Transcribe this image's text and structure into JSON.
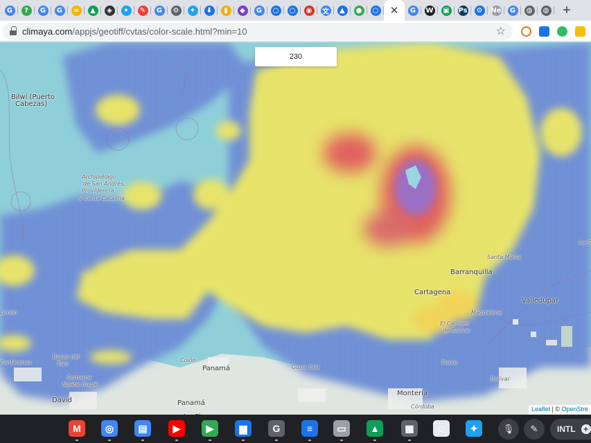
{
  "browser": {
    "tabs": [
      {
        "icon": "google-icon",
        "color": "#4285f4",
        "glyph": "G"
      },
      {
        "icon": "help-icon",
        "color": "#34a853",
        "glyph": "?"
      },
      {
        "icon": "google-icon",
        "color": "#4285f4",
        "glyph": "G"
      },
      {
        "icon": "google-icon",
        "color": "#4285f4",
        "glyph": "G"
      },
      {
        "icon": "infinity-icon",
        "color": "#f4b400",
        "glyph": "∞"
      },
      {
        "icon": "drive-icon",
        "color": "#0f9d58",
        "glyph": "▲"
      },
      {
        "icon": "shield-icon",
        "color": "#333333",
        "glyph": "◈"
      },
      {
        "icon": "twitter-icon",
        "color": "#1da1f2",
        "glyph": "✦"
      },
      {
        "icon": "pen-icon",
        "color": "#ea4335",
        "glyph": "✎"
      },
      {
        "icon": "google-icon",
        "color": "#4285f4",
        "glyph": "G"
      },
      {
        "icon": "search-icon",
        "color": "#5f6368",
        "glyph": "⚙"
      },
      {
        "icon": "twitter-icon",
        "color": "#1da1f2",
        "glyph": "✦"
      },
      {
        "icon": "download-icon",
        "color": "#1a73e8",
        "glyph": "⬇"
      },
      {
        "icon": "analytics-icon",
        "color": "#f9ab00",
        "glyph": "▮"
      },
      {
        "icon": "cube-icon",
        "color": "#7b3fbf",
        "glyph": "◆"
      },
      {
        "icon": "google-icon",
        "color": "#4285f4",
        "glyph": "G"
      },
      {
        "icon": "climaya-icon",
        "color": "#1a73e8",
        "glyph": "○"
      },
      {
        "icon": "climaya-icon",
        "color": "#1a73e8",
        "glyph": "○"
      },
      {
        "icon": "red-app-icon",
        "color": "#d93025",
        "glyph": "◉"
      },
      {
        "icon": "translate-icon",
        "color": "#4285f4",
        "glyph": "文"
      },
      {
        "icon": "triangle-icon",
        "color": "#1a73e8",
        "glyph": "▲"
      },
      {
        "icon": "maps-icon",
        "color": "#34a853",
        "glyph": "●"
      },
      {
        "icon": "climaya-icon",
        "color": "#1a73e8",
        "glyph": "○"
      }
    ],
    "active_tab_close": "✕",
    "tabs_after": [
      {
        "icon": "google-icon",
        "color": "#4285f4",
        "glyph": "G"
      },
      {
        "icon": "wikipedia-icon",
        "color": "#202124",
        "glyph": "W"
      },
      {
        "icon": "map-icon",
        "color": "#0f9d58",
        "glyph": "▣"
      },
      {
        "icon": "photoshop-icon",
        "color": "#0b3a5c",
        "glyph": "Ps"
      },
      {
        "icon": "settings-icon",
        "color": "#1a73e8",
        "glyph": "⚙"
      },
      {
        "icon": "ne-icon",
        "color": "#9aa0a6",
        "glyph": "Ne"
      },
      {
        "icon": "google-icon",
        "color": "#4285f4",
        "glyph": "G"
      },
      {
        "icon": "globe-icon",
        "color": "#5f6368",
        "glyph": "◍"
      },
      {
        "icon": "globe-icon",
        "color": "#5f6368",
        "glyph": "◍"
      }
    ],
    "new_tab": "+",
    "url_host": "climaya.com",
    "url_path": "/appjs/geotiff/cvtas/color-scale.html?min=10",
    "bookmark_star": "☆"
  },
  "map": {
    "value_box": "230",
    "places": [
      {
        "label": "Bilwi (Puerto",
        "size": "big"
      },
      {
        "label": "Cabezas)",
        "size": "big"
      },
      {
        "label": "Archipiélago",
        "size": "small"
      },
      {
        "label": "de San Andrés,",
        "size": "small"
      },
      {
        "label": "Providencia",
        "size": "small"
      },
      {
        "label": "y Santa Catalina",
        "size": "small"
      },
      {
        "label": "Barranquilla",
        "size": "big"
      },
      {
        "label": "Santa Marta",
        "size": "small"
      },
      {
        "label": "Cartagena",
        "size": "big"
      },
      {
        "label": "Magdalena",
        "size": "small"
      },
      {
        "label": "Valledupar",
        "size": "big"
      },
      {
        "label": "El Carmen",
        "size": "small"
      },
      {
        "label": "de Bolívar",
        "size": "small"
      },
      {
        "label": "Sucre",
        "size": "small"
      },
      {
        "label": "Bolívar",
        "size": "small"
      },
      {
        "label": "Montería",
        "size": "big"
      },
      {
        "label": "Córdoba",
        "size": "small"
      },
      {
        "label": "Panamá",
        "size": "big"
      },
      {
        "label": "La Chorrera",
        "size": "big"
      },
      {
        "label": "Panamá",
        "size": "big"
      },
      {
        "label": "Colón",
        "size": "small"
      },
      {
        "label": "Guna Yala",
        "size": "small"
      },
      {
        "label": "Bocas del",
        "size": "small"
      },
      {
        "label": "Toro",
        "size": "small"
      },
      {
        "label": "Comarca",
        "size": "small"
      },
      {
        "label": "Ngäbe Buglé",
        "size": "small"
      },
      {
        "label": "David",
        "size": "big"
      },
      {
        "label": "Limón",
        "size": "small"
      },
      {
        "label": "Puntarenas",
        "size": "small"
      },
      {
        "label": "La Gu",
        "size": "small"
      }
    ],
    "attribution_leaflet": "Leaflet",
    "attribution_sep": " | © ",
    "attribution_osm": "OpenStre"
  },
  "shelf": {
    "apps": [
      {
        "name": "gmail-icon",
        "color": "#ea4335",
        "glyph": "M"
      },
      {
        "name": "chrome-icon",
        "color": "#4285f4",
        "glyph": "◎"
      },
      {
        "name": "docs-icon",
        "color": "#4285f4",
        "glyph": "▤"
      },
      {
        "name": "youtube-icon",
        "color": "#ff0000",
        "glyph": "▶"
      },
      {
        "name": "play-store-icon",
        "color": "#34a853",
        "glyph": "▶"
      },
      {
        "name": "files-icon",
        "color": "#1a73e8",
        "glyph": "▆"
      },
      {
        "name": "google-app-icon",
        "color": "#5f6368",
        "glyph": "G"
      },
      {
        "name": "messages-icon",
        "color": "#1a73e8",
        "glyph": "≡"
      },
      {
        "name": "chrome-window-icon",
        "color": "#9aa0a6",
        "glyph": "▭"
      },
      {
        "name": "drive-icon",
        "color": "#0f9d58",
        "glyph": "▲"
      },
      {
        "name": "calculator-icon",
        "color": "#5f6368",
        "glyph": "▦"
      },
      {
        "name": "owl-icon",
        "color": "#e8eaed",
        "glyph": "☺"
      },
      {
        "name": "twitter-icon",
        "color": "#1da1f2",
        "glyph": "✦"
      }
    ],
    "mic": "🎙",
    "pen": "✎",
    "ime": "INTL",
    "plus": "+"
  }
}
